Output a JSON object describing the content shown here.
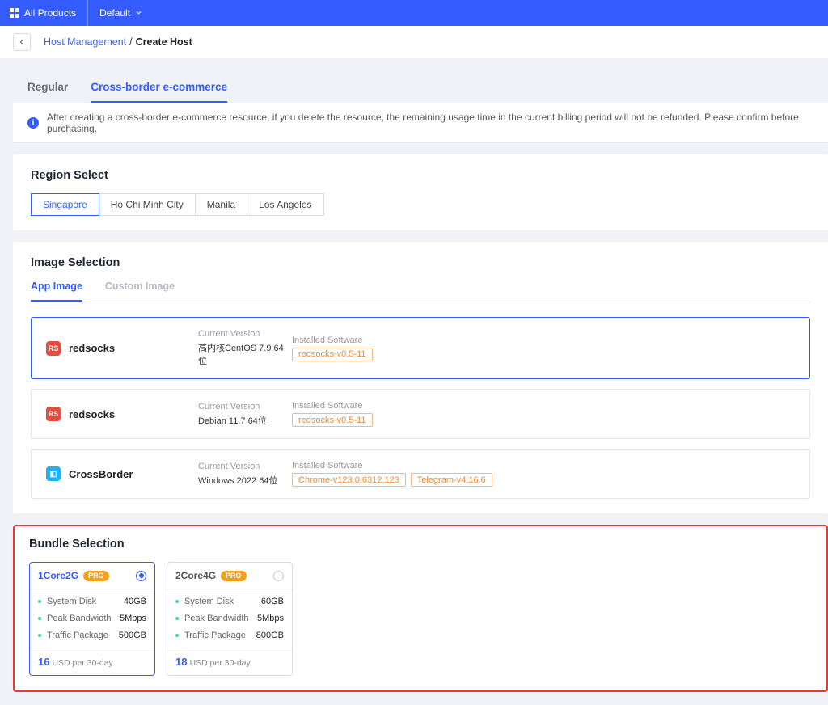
{
  "topbar": {
    "all_products": "All Products",
    "default_dropdown": "Default"
  },
  "breadcrumb": {
    "parent": "Host Management",
    "current": "Create Host"
  },
  "type_tabs": {
    "regular": "Regular",
    "cbec": "Cross-border e-commerce",
    "active": "cbec"
  },
  "notice": "After creating a cross-border e-commerce resource, if you delete the resource, the remaining usage time in the current billing period will not be refunded. Please confirm before purchasing.",
  "region": {
    "title": "Region Select",
    "options": [
      "Singapore",
      "Ho Chi Minh City",
      "Manila",
      "Los Angeles"
    ],
    "active": 0
  },
  "image_selection": {
    "title": "Image Selection",
    "tabs": {
      "app": "App Image",
      "custom": "Custom Image",
      "active": "app"
    },
    "items": [
      {
        "name": "redsocks",
        "icon_bg": "#e94b3c",
        "icon_txt": "RS",
        "cv_label": "Current Version",
        "cv_value": "高内核CentOS 7.9 64位",
        "is_label": "Installed Software",
        "software": [
          "redsocks-v0.5-11"
        ],
        "active": true
      },
      {
        "name": "redsocks",
        "icon_bg": "#e94b3c",
        "icon_txt": "RS",
        "cv_label": "Current Version",
        "cv_value": "Debian 11.7 64位",
        "is_label": "Installed Software",
        "software": [
          "redsocks-v0.5-11"
        ],
        "active": false
      },
      {
        "name": "CrossBorder",
        "icon_bg": "#1fb1f0",
        "icon_txt": "◧",
        "cv_label": "Current Version",
        "cv_value": "Windows 2022 64位",
        "is_label": "Installed Software",
        "software": [
          "Chrome-v123.0.6312.123",
          "Telegram-v4.16.6"
        ],
        "active": false
      }
    ]
  },
  "bundles": {
    "title": "Bundle Selection",
    "pro_label": "PRO",
    "labels": {
      "disk": "System Disk",
      "bw": "Peak Bandwidth",
      "traffic": "Traffic Package"
    },
    "items": [
      {
        "name": "1Core2G",
        "disk": "40GB",
        "bw": "5Mbps",
        "traffic": "500GB",
        "price": "16",
        "price_suffix": "USD per 30-day",
        "active": true
      },
      {
        "name": "2Core4G",
        "disk": "60GB",
        "bw": "5Mbps",
        "traffic": "800GB",
        "price": "18",
        "price_suffix": "USD per 30-day",
        "active": false
      }
    ]
  }
}
